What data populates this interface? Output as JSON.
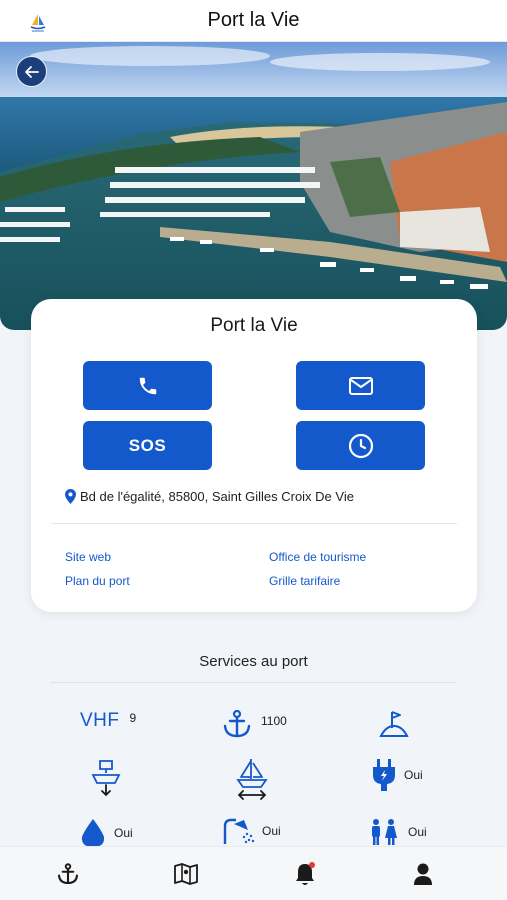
{
  "header": {
    "title": "Port la Vie",
    "logo_icon": "port-logo-icon"
  },
  "hero": {
    "image_description_icon": "harbor-aerial-photo",
    "back_icon": "arrow-left-icon"
  },
  "card": {
    "title": "Port la Vie",
    "actions": [
      {
        "name": "call",
        "icon": "phone-icon"
      },
      {
        "name": "email",
        "icon": "mail-icon"
      },
      {
        "name": "sos",
        "label": "SOS"
      },
      {
        "name": "hours",
        "icon": "clock-icon"
      }
    ],
    "address": "Bd de l'égalité, 85800, Saint Gilles Croix De Vie",
    "links": {
      "website": "Site web",
      "tourism": "Office de tourisme",
      "port_map": "Plan du port",
      "pricing": "Grille tarifaire"
    }
  },
  "services": {
    "title": "Services au port",
    "vhf": {
      "label": "VHF",
      "value": "9"
    },
    "anchor": {
      "icon": "anchor-icon",
      "value": "1100"
    },
    "capitainerie": {
      "icon": "harbor-flag-icon"
    },
    "crane": {
      "icon": "boat-lift-icon"
    },
    "boat_size": {
      "icon": "sailboat-width-icon"
    },
    "electricity": {
      "icon": "power-plug-icon",
      "value": "Oui"
    },
    "water": {
      "icon": "water-drop-icon",
      "value": "Oui"
    },
    "shower": {
      "icon": "shower-icon",
      "value": "Oui"
    },
    "toilets": {
      "icon": "restroom-icon",
      "value": "Oui"
    }
  },
  "nav": {
    "items": [
      "anchor-icon",
      "map-icon",
      "bell-icon",
      "user-icon"
    ],
    "accent": "#1459cc",
    "notification_dot": "#e53935"
  },
  "colors": {
    "primary": "#1459cc",
    "back_button": "#1b3f7a"
  }
}
